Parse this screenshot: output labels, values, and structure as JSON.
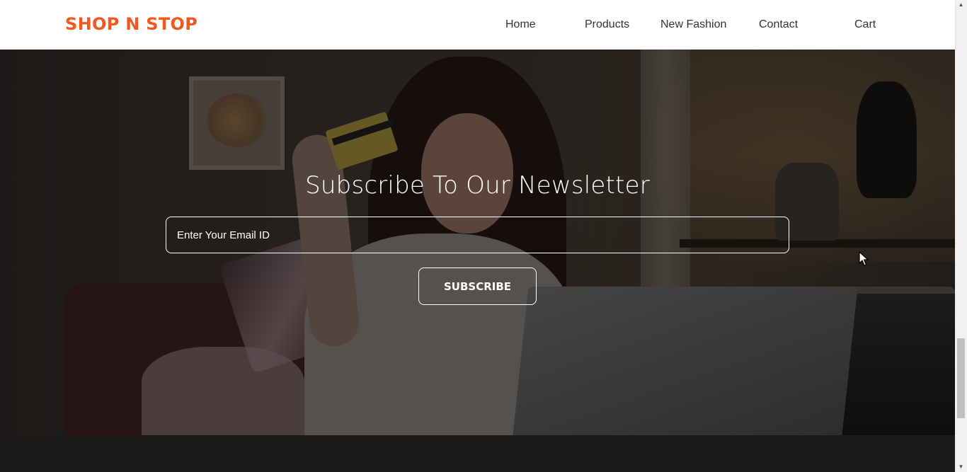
{
  "brand": {
    "name": "SHOP N STOP",
    "color": "#f2571d"
  },
  "nav": {
    "home": "Home",
    "products": "Products",
    "new_fashion": "New Fashion",
    "contact": "Contact",
    "cart": "Cart"
  },
  "newsletter": {
    "title": "Subscribe To Our Newsletter",
    "email_placeholder": "Enter Your Email ID",
    "email_value": "",
    "subscribe_label": "SUBSCRIBE"
  },
  "icons": {
    "scroll_up": "chevron-up-icon",
    "scroll_down": "chevron-down-icon",
    "cursor": "mouse-pointer-icon"
  },
  "colors": {
    "accent": "#f2571d",
    "footer": "#1b1b1b",
    "header": "#ffffff"
  }
}
